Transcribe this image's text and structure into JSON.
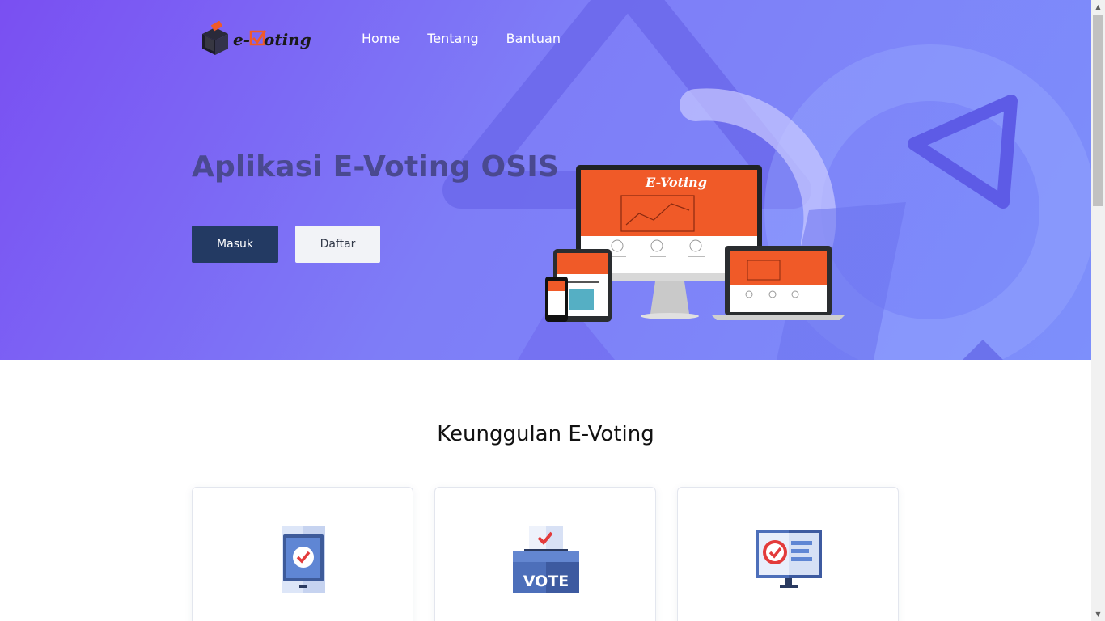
{
  "brand": {
    "logo_text_prefix": "e-",
    "logo_text_suffix": "oting"
  },
  "nav": {
    "items": [
      {
        "label": "Home"
      },
      {
        "label": "Tentang"
      },
      {
        "label": "Bantuan"
      }
    ]
  },
  "hero": {
    "title": "Aplikasi E-Voting OSIS",
    "masuk_label": "Masuk",
    "daftar_label": "Daftar",
    "screen_brand": "E-Voting"
  },
  "features": {
    "title": "Keunggulan E-Voting",
    "vote_label": "VOTE"
  },
  "colors": {
    "hero_start": "#7a4ff2",
    "hero_end": "#7d8ffb",
    "primary_button": "#233a63",
    "accent_orange": "#f05a28",
    "check_red": "#e33b3b"
  }
}
